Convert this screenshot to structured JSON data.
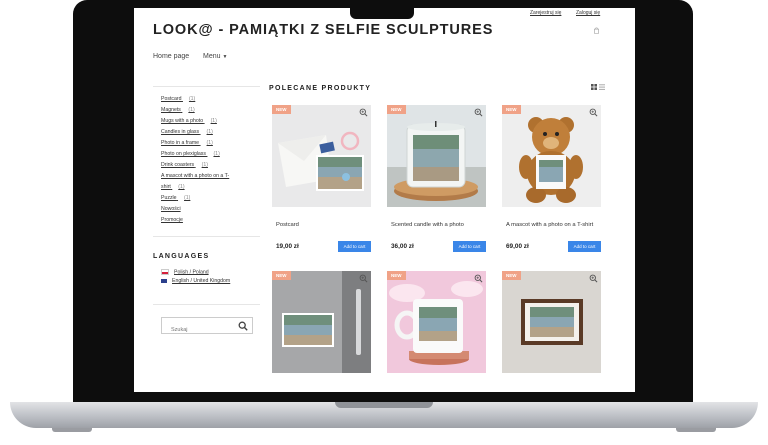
{
  "header": {
    "register_label": "Zarejestruj się",
    "login_label": "Zaloguj się",
    "site_title": "LOOK@ - PAMIĄTKI Z SELFIE SCULPTURES",
    "nav": {
      "home": "Home page",
      "menu": "Menu"
    }
  },
  "categories": [
    {
      "label": "Postcard",
      "count": "(1)"
    },
    {
      "label": "Magnets",
      "count": "(1)"
    },
    {
      "label": "Mugs with a photo",
      "count": "(1)"
    },
    {
      "label": "Candles in glass",
      "count": "(1)"
    },
    {
      "label": "Photo in a frame",
      "count": "(1)"
    },
    {
      "label": "Photo on plexiglass",
      "count": "(1)"
    },
    {
      "label": "Drink coasters",
      "count": "(1)"
    },
    {
      "label": "A mascot with a photo on a T-",
      "count": ""
    },
    {
      "label": "shirt",
      "count": "(1)"
    },
    {
      "label": "Puzzle",
      "count": "(1)"
    },
    {
      "label": "Nowości",
      "count": ""
    },
    {
      "label": "Promocje",
      "count": ""
    }
  ],
  "languages": {
    "heading": "LANGUAGES",
    "items": [
      {
        "label": "Polish / Poland"
      },
      {
        "label": "English / United Kingdom"
      }
    ]
  },
  "search": {
    "placeholder": "Szukaj"
  },
  "featured": {
    "heading": "POLECANE PRODUKTY",
    "products": [
      {
        "badge": "NEW",
        "name": "Postcard",
        "price": "19,00 zł",
        "cta": "Add to cart"
      },
      {
        "badge": "NEW",
        "name": "Scented candle with a photo",
        "price": "36,00 zł",
        "cta": "Add to cart"
      },
      {
        "badge": "NEW",
        "name": "A mascot with a photo on a T-shirt",
        "price": "69,00 zł",
        "cta": "Add to cart"
      },
      {
        "badge": "NEW",
        "name": "",
        "price": "",
        "cta": ""
      },
      {
        "badge": "NEW",
        "name": "",
        "price": "",
        "cta": ""
      },
      {
        "badge": "NEW",
        "name": "",
        "price": "",
        "cta": ""
      }
    ]
  }
}
